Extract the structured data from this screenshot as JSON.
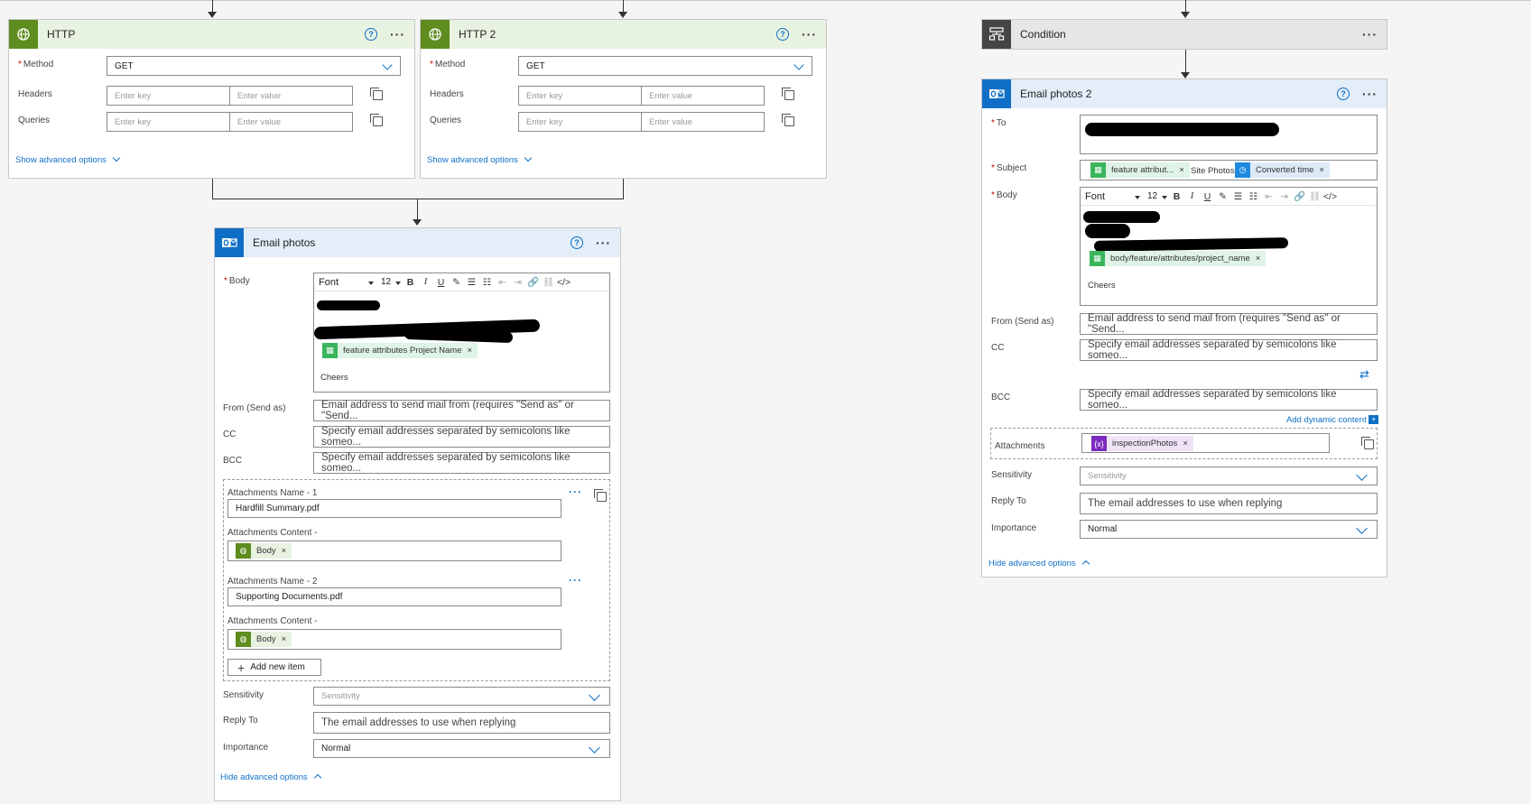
{
  "http1": {
    "title": "HTTP",
    "method_label": "Method",
    "method_value": "GET",
    "headers_label": "Headers",
    "queries_label": "Queries",
    "key_placeholder": "Enter key",
    "value_placeholder": "Enter value",
    "show_advanced": "Show advanced options"
  },
  "http2": {
    "title": "HTTP 2",
    "method_label": "Method",
    "method_value": "GET",
    "headers_label": "Headers",
    "queries_label": "Queries",
    "key_placeholder": "Enter key",
    "value_placeholder": "Enter value",
    "show_advanced": "Show advanced options"
  },
  "email1": {
    "title": "Email photos",
    "body_label": "Body",
    "toolbar": {
      "font": "Font",
      "size": "12"
    },
    "body_token": "feature attributes Project Name",
    "body_footer": "Cheers",
    "from_label": "From (Send as)",
    "from_placeholder": "Email address to send mail from (requires \"Send as\" or \"Send...",
    "cc_label": "CC",
    "cc_placeholder": "Specify email addresses separated by semicolons like someo...",
    "bcc_label": "BCC",
    "bcc_placeholder": "Specify email addresses separated by semicolons like someo...",
    "attachments": [
      {
        "name_label": "Attachments Name - 1",
        "name_value": "Hardfill Summary.pdf",
        "content_label": "Attachments Content -",
        "content_token": "Body"
      },
      {
        "name_label": "Attachments Name - 2",
        "name_value": "Supporting Documents.pdf",
        "content_label": "Attachments Content -",
        "content_token": "Body"
      }
    ],
    "add_item": "Add new item",
    "sensitivity_label": "Sensitivity",
    "sensitivity_placeholder": "Sensitivity",
    "replyto_label": "Reply To",
    "replyto_placeholder": "The email addresses to use when replying",
    "importance_label": "Importance",
    "importance_value": "Normal",
    "hide_advanced": "Hide advanced options"
  },
  "condition": {
    "title": "Condition"
  },
  "email2": {
    "title": "Email photos 2",
    "to_label": "To",
    "subject_label": "Subject",
    "subject_token1": "feature attribut...",
    "subject_text": "Site Photos",
    "subject_token2": "Converted time",
    "body_label": "Body",
    "toolbar": {
      "font": "Font",
      "size": "12"
    },
    "body_token": "body/feature/attributes/project_name",
    "body_footer": "Cheers",
    "from_label": "From (Send as)",
    "from_placeholder": "Email address to send mail from (requires \"Send as\" or \"Send...",
    "cc_label": "CC",
    "cc_placeholder": "Specify email addresses separated by semicolons like someo...",
    "bcc_label": "BCC",
    "bcc_placeholder": "Specify email addresses separated by semicolons like someo...",
    "add_dynamic": "Add dynamic content",
    "attachments_label": "Attachments",
    "attachments_token": "inspectionPhotos",
    "sensitivity_label": "Sensitivity",
    "sensitivity_placeholder": "Sensitivity",
    "replyto_label": "Reply To",
    "replyto_placeholder": "The email addresses to use when replying",
    "importance_label": "Importance",
    "importance_value": "Normal",
    "hide_advanced": "Hide advanced options"
  }
}
